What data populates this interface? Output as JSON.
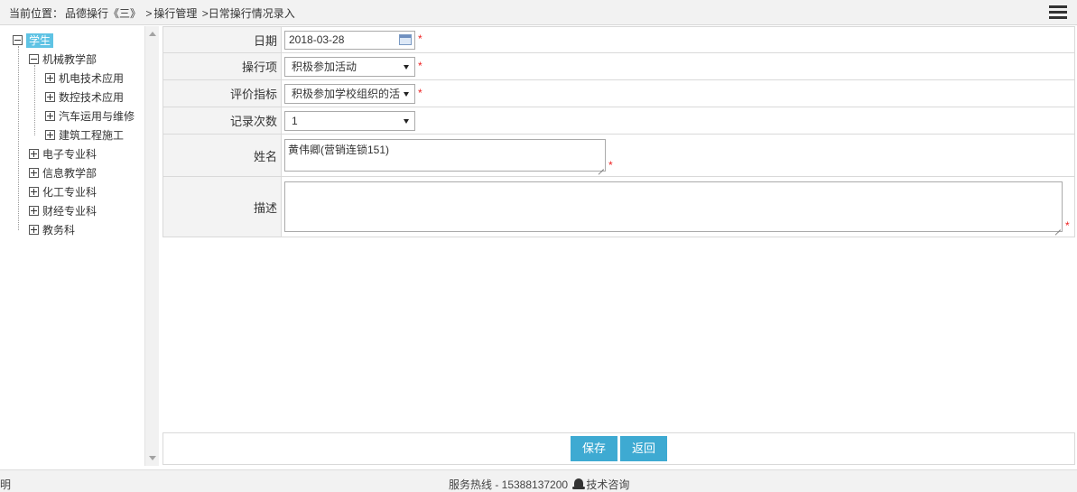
{
  "breadcrumb": {
    "prefix": "当前位置：",
    "items": [
      "品德操行《三》",
      ">",
      "操行管理",
      ">日常操行情况录入"
    ]
  },
  "tree": {
    "root": "学生",
    "nodes": [
      {
        "label": "机械教学部"
      },
      {
        "label": "机电技术应用"
      },
      {
        "label": "数控技术应用"
      },
      {
        "label": "汽车运用与维修"
      },
      {
        "label": "建筑工程施工"
      },
      {
        "label": "电子专业科"
      },
      {
        "label": "信息教学部"
      },
      {
        "label": "化工专业科"
      },
      {
        "label": "财经专业科"
      },
      {
        "label": "教务科"
      }
    ]
  },
  "form": {
    "date_label": "日期",
    "date_value": "2018-03-28",
    "item_label": "操行项",
    "item_value": "积极参加活动",
    "index_label": "评价指标",
    "index_value": "积极参加学校组织的活",
    "count_label": "记录次数",
    "count_value": "1",
    "name_label": "姓名",
    "name_value": "黄伟卿(营销连锁151)",
    "desc_label": "描述",
    "desc_value": "",
    "required_mark": "*"
  },
  "actions": {
    "save": "保存",
    "back": "返回"
  },
  "footer": {
    "left": "明",
    "hotline": "服务热线 - 15388137200",
    "consult": "技术咨询"
  },
  "colors": {
    "accent": "#3eaad2",
    "tree_active": "#5fc3e4",
    "required": "#ee2222"
  }
}
